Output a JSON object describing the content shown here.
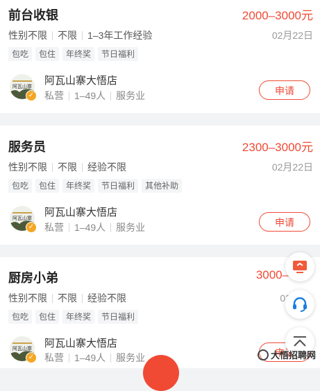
{
  "jobs": [
    {
      "title": "前台收银",
      "salary": "2000–3000元",
      "gender": "性别不限",
      "age": "不限",
      "experience": "1–3年工作经验",
      "date": "02月22日",
      "tags": [
        "包吃",
        "包住",
        "年终奖",
        "节日福利"
      ],
      "company": "阿瓦山寨大悟店",
      "company_type": "私营",
      "company_size": "1–49人",
      "industry": "服务业",
      "apply_label": "申请"
    },
    {
      "title": "服务员",
      "salary": "2300–3000元",
      "gender": "性别不限",
      "age": "不限",
      "experience": "经验不限",
      "date": "02月22日",
      "tags": [
        "包吃",
        "包住",
        "年终奖",
        "节日福利",
        "其他补助"
      ],
      "company": "阿瓦山寨大悟店",
      "company_type": "私营",
      "company_size": "1–49人",
      "industry": "服务业",
      "apply_label": "申请"
    },
    {
      "title": "厨房小弟",
      "salary": "3000–40",
      "gender": "性别不限",
      "age": "不限",
      "experience": "经验不限",
      "date": "02月",
      "tags": [
        "包吃",
        "包住",
        "年终奖",
        "节日福利"
      ],
      "company": "阿瓦山寨大悟店",
      "company_type": "私营",
      "company_size": "1–49人",
      "industry": "服务业",
      "apply_label": "申请"
    }
  ],
  "logo_text": "阿瓦山寨",
  "watermark": "大悟招聘网",
  "floating_icons": [
    "monitor-icon",
    "headset-icon",
    "back-to-top-icon"
  ],
  "colors": {
    "accent": "#f04a35",
    "badge": "#f5a623",
    "icon": "#f05a3a",
    "headset": "#1a7de0"
  }
}
